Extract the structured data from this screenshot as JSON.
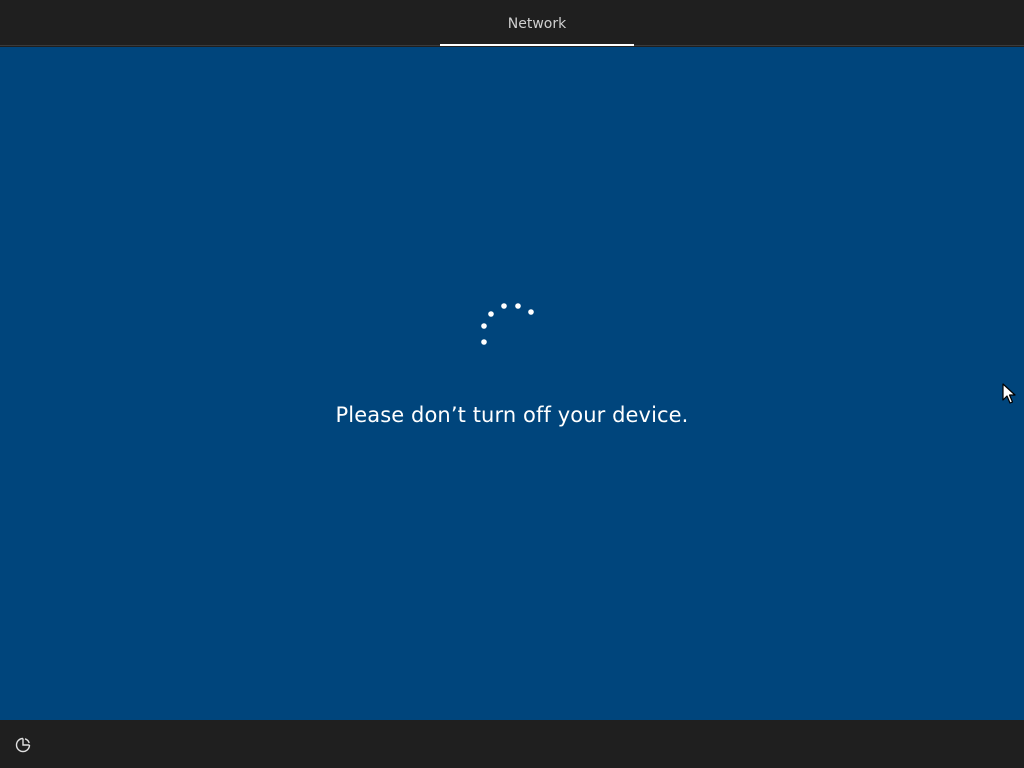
{
  "header": {
    "current_step": "Network"
  },
  "main": {
    "message": "Please don’t turn off your device."
  },
  "icons": {
    "spinner": "loading-spinner-icon",
    "ease_of_access": "ease-of-access-icon",
    "cursor": "mouse-cursor-icon"
  },
  "colors": {
    "background_blue": "#00457c",
    "bars": "#1f1f1f",
    "text": "#ffffff"
  }
}
